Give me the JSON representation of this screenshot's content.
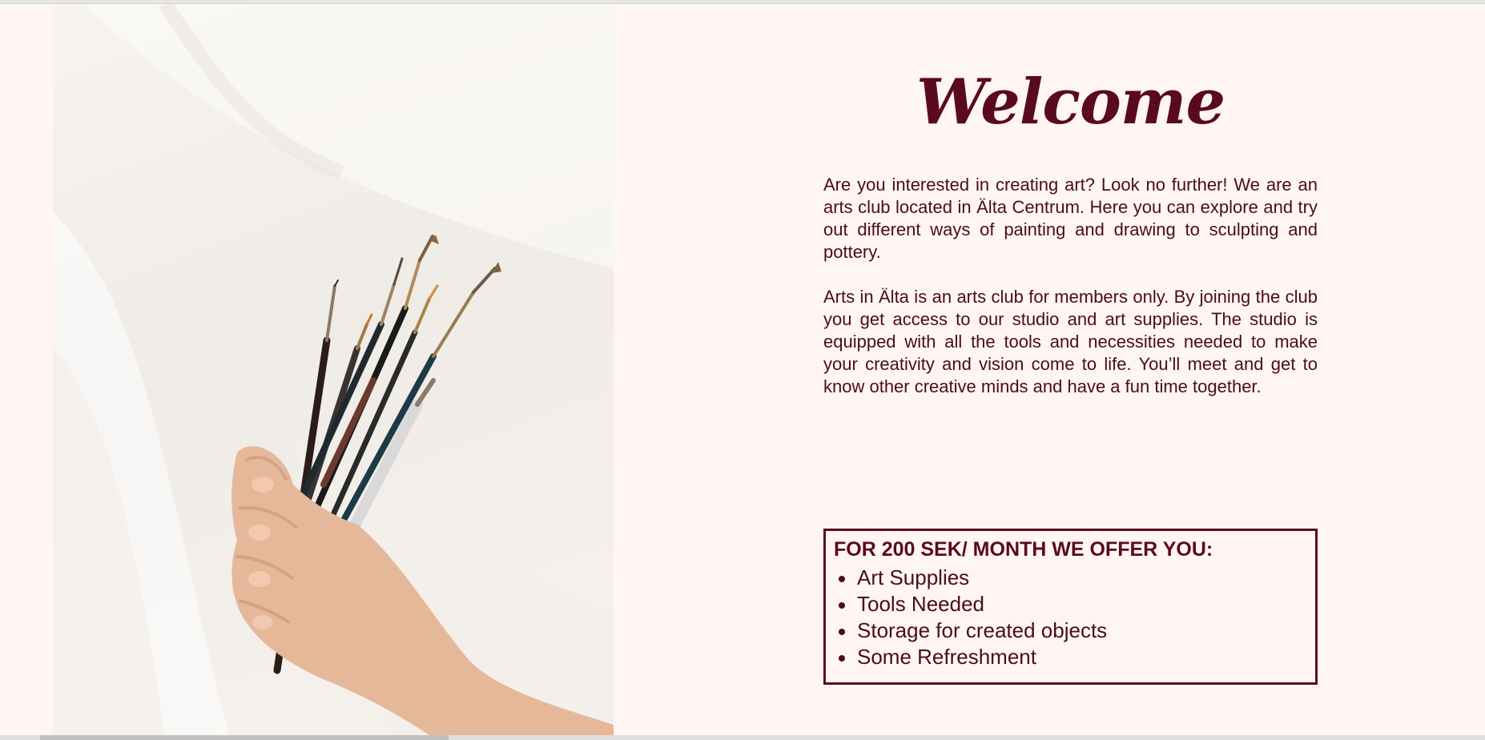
{
  "welcome": {
    "title": "Welcome"
  },
  "intro": {
    "paragraph_1": "Are you interested in creating art? Look no further! We are an arts club located in Älta Centrum. Here you can explore and try out different ways of painting and drawing to sculpting and pottery.",
    "paragraph_2": "Arts in Älta is an arts club for members only. By joining the club you get access to our studio and art supplies. The studio is equipped with all the tools and necessities needed to make your creativity and vision come to life. You’ll meet and get to know other creative minds and have a fun time together."
  },
  "offer": {
    "heading": "FOR 200 SEK/ MONTH WE OFFER YOU:",
    "items": [
      {
        "label": "Art Supplies"
      },
      {
        "label": "Tools Needed"
      },
      {
        "label": "Storage for created objects"
      },
      {
        "label": "Some Refreshment"
      }
    ]
  },
  "colors": {
    "accent": "#5a0a1e",
    "text": "#4a0c1d",
    "background": "#fff5f2"
  },
  "images": {
    "hero": "hand-holding-paintbrushes-photo"
  }
}
